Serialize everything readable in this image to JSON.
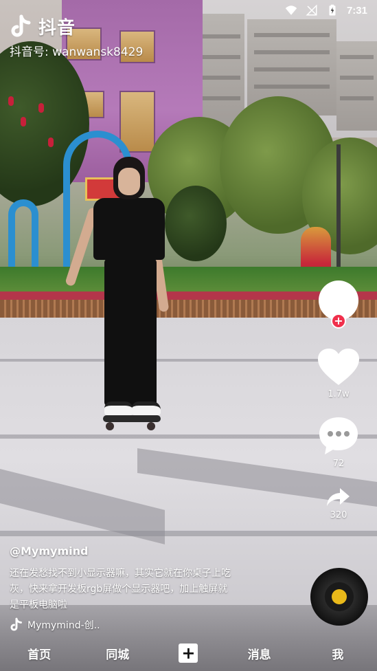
{
  "status_bar": {
    "time": "7:31",
    "icons": [
      "wifi-icon",
      "signal-off-icon",
      "battery-charging-icon"
    ]
  },
  "watermark": {
    "app_name": "抖音",
    "user_id": "抖音号: wanwansk8429"
  },
  "side_rail": {
    "like_count": "1.7w",
    "comment_count": "72",
    "share_count": "320"
  },
  "post": {
    "author": "@Mymymind",
    "description": "还在发愁找不到小显示器嘛，其实它就在你桌子上吃灰，快来拿开发板rgb屏做个显示器吧，加上触屏就是平板电脑啦",
    "music": "Mymymind-创.."
  },
  "tabs": {
    "home": "首页",
    "nearby": "同城",
    "add": "+",
    "messages": "消息",
    "me": "我"
  },
  "colors": {
    "follow_badge": "#f0304c",
    "disc_center": "#e9b91a",
    "overlay_text": "#ffffff"
  }
}
